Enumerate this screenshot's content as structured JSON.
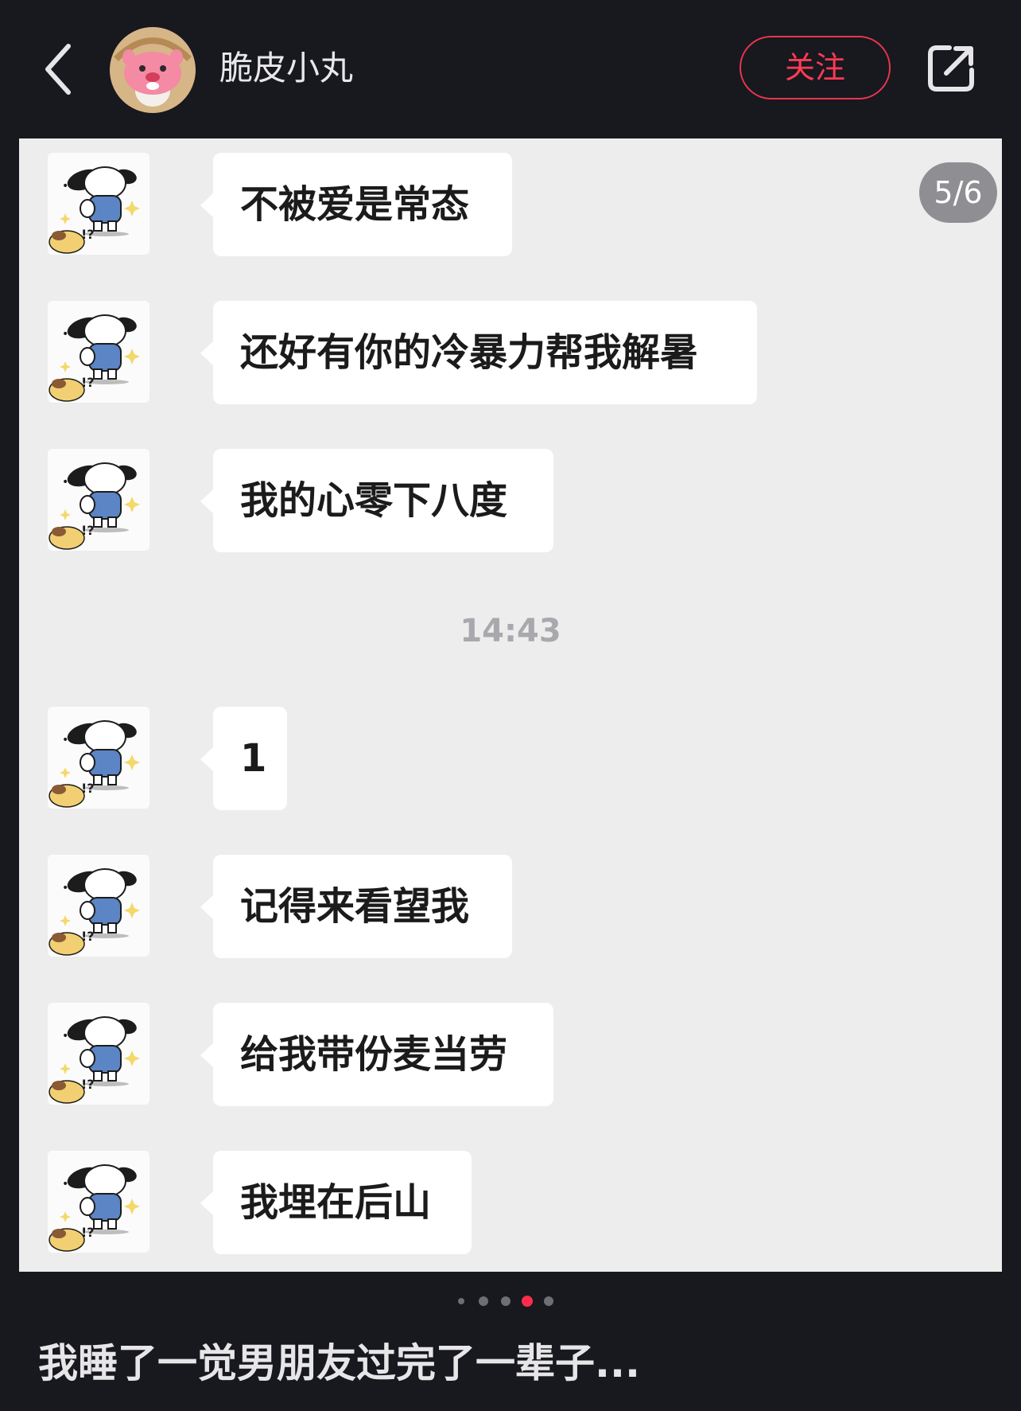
{
  "header": {
    "username": "脆皮小丸",
    "follow_label": "关注"
  },
  "page_indicator": "5/6",
  "messages_before": [
    "不被爱是常态",
    "还好有你的冷暴力帮我解暑",
    "我的心零下八度"
  ],
  "timestamp": "14:43",
  "messages_after": [
    "1",
    "记得来看望我",
    "给我带份麦当劳",
    "我埋在后山"
  ],
  "carousel": {
    "total": 5,
    "active_index": 3
  },
  "post_title": "我睡了一觉男朋友过完了一辈子...",
  "colors": {
    "accent": "#ff2d4b",
    "background": "#18181f",
    "chat_background": "#ededed",
    "bubble": "#ffffff"
  }
}
